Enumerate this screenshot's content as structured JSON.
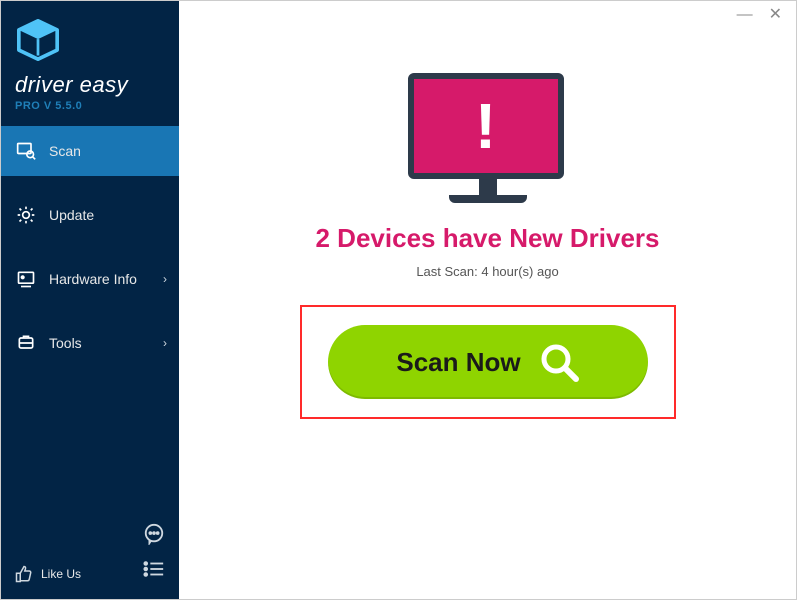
{
  "brand": {
    "name": "driver easy",
    "version": "PRO V 5.5.0"
  },
  "sidebar": {
    "items": [
      {
        "label": "Scan"
      },
      {
        "label": "Update"
      },
      {
        "label": "Hardware Info"
      },
      {
        "label": "Tools"
      }
    ],
    "like_us": "Like Us"
  },
  "main": {
    "headline": "2 Devices have New Drivers",
    "last_scan": "Last Scan: 4 hour(s) ago",
    "scan_button": "Scan Now"
  }
}
